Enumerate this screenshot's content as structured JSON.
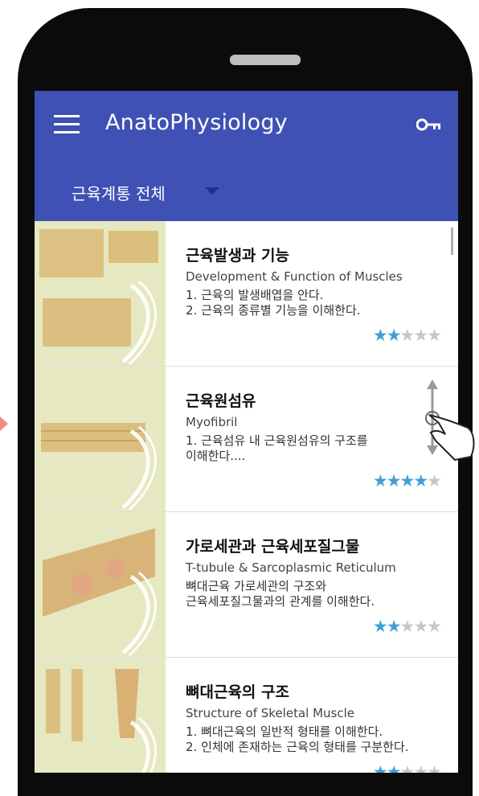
{
  "app": {
    "title": "AnatoPhysiology"
  },
  "toolbar": {
    "category": "근육계통 전체"
  },
  "lessons": [
    {
      "title": "근육발생과 기능",
      "subtitle": "Development & Function of Muscles",
      "desc1": "1. 근육의 발생배엽을 안다.",
      "desc2": "2. 근육의 종류별 기능을 이해한다.",
      "rating": 2
    },
    {
      "title": "근육원섬유",
      "subtitle": "Myofibril",
      "desc1": "1. 근육섬유 내 근육원섬유의 구조를",
      "desc2": "이해한다....",
      "rating": 4
    },
    {
      "title": "가로세관과 근육세포질그물",
      "subtitle": "T-tubule & Sarcoplasmic Reticulum",
      "desc1": "뼈대근육 가로세관의 구조와",
      "desc2": "근육세포질그물과의 관계를 이해한다.",
      "rating": 2
    },
    {
      "title": "뼈대근육의 구조",
      "subtitle": "Structure of Skeletal Muscle",
      "desc1": "1. 뼈대근육의 일반적 형태를 이해한다.",
      "desc2": "2. 인체에 존재하는 근육의 형태를 구분한다.",
      "rating": 2
    }
  ],
  "rating_max": 5,
  "icons": {
    "menu": "menu-icon",
    "key": "key-icon",
    "dropdown": "dropdown-arrow-icon",
    "star": "star-icon",
    "hand": "hand-pointer-icon"
  },
  "colors": {
    "appbar": "#3f51b5",
    "star_on": "#3fa0d6",
    "star_off": "#c7c7c7",
    "thumb_bg": "#e9ecc6"
  }
}
